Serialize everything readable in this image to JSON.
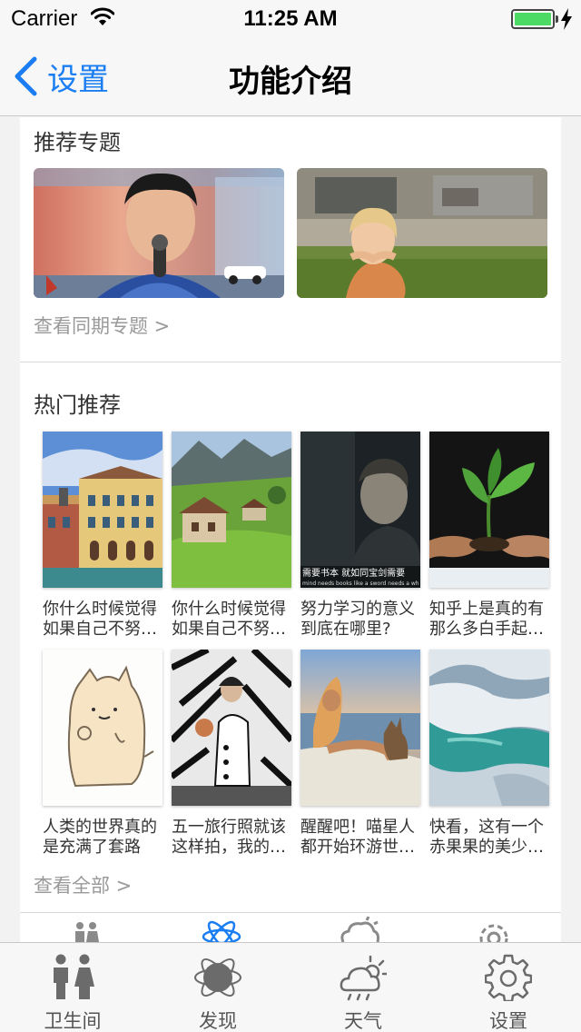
{
  "status_bar": {
    "carrier": "Carrier",
    "time": "11:25 AM",
    "battery_level": 1.0
  },
  "nav": {
    "back_label": "设置",
    "title": "功能介绍"
  },
  "topics": {
    "title": "推荐专题",
    "more": "查看同期专题 >"
  },
  "hot": {
    "title": "热门推荐",
    "items": [
      {
        "title": "你什么时候觉得如果自己不努…"
      },
      {
        "title": "你什么时候觉得如果自己不努…"
      },
      {
        "title": "努力学习的意义到底在哪里?"
      },
      {
        "title": "知乎上是真的有那么多白手起…"
      },
      {
        "title": "人类的世界真的是充满了套路"
      },
      {
        "title": "五一旅行照就该这样拍，我的…"
      },
      {
        "title": "醒醒吧！喵星人都开始环游世…"
      },
      {
        "title": "快看，这有一个赤果果的美少…"
      }
    ],
    "more": "查看全部 >",
    "thumb_captions": {
      "line1": "需要书本  就如同宝剑需要",
      "line2": "mind needs books like a sword needs a wh"
    }
  },
  "tabs": [
    {
      "label": "卫生间",
      "icon": "restroom-icon"
    },
    {
      "label": "发现",
      "icon": "discover-icon"
    },
    {
      "label": "天气",
      "icon": "weather-icon"
    },
    {
      "label": "设置",
      "icon": "gear-icon"
    }
  ],
  "colors": {
    "accent": "#1a7ef2",
    "tab_active": "#1a7ef2",
    "tab_icon": "#6b6b6b",
    "battery": "#4cd964"
  }
}
